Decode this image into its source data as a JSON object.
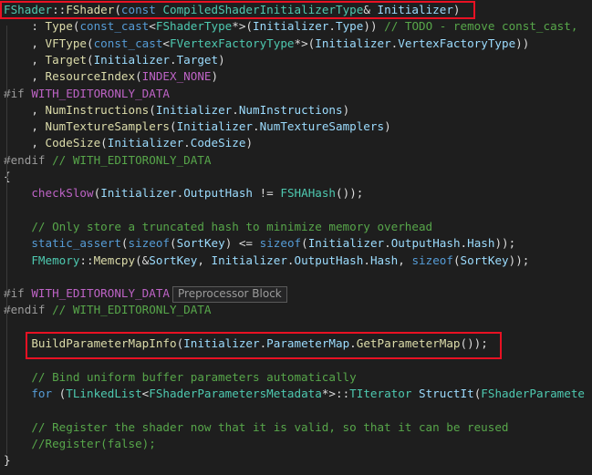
{
  "editor": {
    "lines": [
      {
        "tokens": [
          [
            "ty",
            "FShader"
          ],
          [
            "m",
            "::"
          ],
          [
            "fn",
            "FShader"
          ],
          [
            "m",
            "("
          ],
          [
            "kw",
            "const"
          ],
          [
            "m",
            " "
          ],
          [
            "ty",
            "CompiledShaderInitializerType"
          ],
          [
            "m",
            "& "
          ],
          [
            "var",
            "Initializer"
          ],
          [
            "m",
            ")"
          ]
        ]
      },
      {
        "tokens": [
          [
            "m",
            "    : "
          ],
          [
            "fn",
            "Type"
          ],
          [
            "m",
            "("
          ],
          [
            "kw",
            "const_cast"
          ],
          [
            "m",
            "<"
          ],
          [
            "ty",
            "FShaderType"
          ],
          [
            "m",
            "*>("
          ],
          [
            "var",
            "Initializer"
          ],
          [
            "m",
            "."
          ],
          [
            "field",
            "Type"
          ],
          [
            "m",
            ")) "
          ],
          [
            "cm",
            "// TODO - remove const_cast,"
          ]
        ]
      },
      {
        "tokens": [
          [
            "m",
            "    , "
          ],
          [
            "fn",
            "VFType"
          ],
          [
            "m",
            "("
          ],
          [
            "kw",
            "const_cast"
          ],
          [
            "m",
            "<"
          ],
          [
            "ty",
            "FVertexFactoryType"
          ],
          [
            "m",
            "*>("
          ],
          [
            "var",
            "Initializer"
          ],
          [
            "m",
            "."
          ],
          [
            "field",
            "VertexFactoryType"
          ],
          [
            "m",
            "))"
          ]
        ]
      },
      {
        "tokens": [
          [
            "m",
            "    , "
          ],
          [
            "fn",
            "Target"
          ],
          [
            "m",
            "("
          ],
          [
            "var",
            "Initializer"
          ],
          [
            "m",
            "."
          ],
          [
            "field",
            "Target"
          ],
          [
            "m",
            ")"
          ]
        ]
      },
      {
        "tokens": [
          [
            "m",
            "    , "
          ],
          [
            "fn",
            "ResourceIndex"
          ],
          [
            "m",
            "("
          ],
          [
            "idx",
            "INDEX_NONE"
          ],
          [
            "m",
            ")"
          ]
        ]
      },
      {
        "tokens": [
          [
            "pp",
            "#if "
          ],
          [
            "mac",
            "WITH_EDITORONLY_DATA"
          ]
        ]
      },
      {
        "tokens": [
          [
            "m",
            "    , "
          ],
          [
            "fn",
            "NumInstructions"
          ],
          [
            "m",
            "("
          ],
          [
            "var",
            "Initializer"
          ],
          [
            "m",
            "."
          ],
          [
            "field",
            "NumInstructions"
          ],
          [
            "m",
            ")"
          ]
        ]
      },
      {
        "tokens": [
          [
            "m",
            "    , "
          ],
          [
            "fn",
            "NumTextureSamplers"
          ],
          [
            "m",
            "("
          ],
          [
            "var",
            "Initializer"
          ],
          [
            "m",
            "."
          ],
          [
            "field",
            "NumTextureSamplers"
          ],
          [
            "m",
            ")"
          ]
        ]
      },
      {
        "tokens": [
          [
            "m",
            "    , "
          ],
          [
            "fn",
            "CodeSize"
          ],
          [
            "m",
            "("
          ],
          [
            "var",
            "Initializer"
          ],
          [
            "m",
            "."
          ],
          [
            "field",
            "CodeSize"
          ],
          [
            "m",
            ")"
          ]
        ]
      },
      {
        "tokens": [
          [
            "pp",
            "#endif "
          ],
          [
            "cm",
            "// WITH_EDITORONLY_DATA"
          ]
        ]
      },
      {
        "tokens": [
          [
            "m",
            "{"
          ]
        ]
      },
      {
        "tokens": [
          [
            "m",
            "    "
          ],
          [
            "mac",
            "checkSlow"
          ],
          [
            "m",
            "("
          ],
          [
            "var",
            "Initializer"
          ],
          [
            "m",
            "."
          ],
          [
            "field",
            "OutputHash"
          ],
          [
            "m",
            " != "
          ],
          [
            "ty",
            "FSHAHash"
          ],
          [
            "m",
            "());"
          ]
        ]
      },
      {
        "tokens": [
          [
            "m",
            ""
          ]
        ]
      },
      {
        "tokens": [
          [
            "m",
            "    "
          ],
          [
            "cm",
            "// Only store a truncated hash to minimize memory overhead"
          ]
        ]
      },
      {
        "tokens": [
          [
            "m",
            "    "
          ],
          [
            "kw",
            "static_assert"
          ],
          [
            "m",
            "("
          ],
          [
            "kw",
            "sizeof"
          ],
          [
            "m",
            "("
          ],
          [
            "field",
            "SortKey"
          ],
          [
            "m",
            ") <= "
          ],
          [
            "kw",
            "sizeof"
          ],
          [
            "m",
            "("
          ],
          [
            "var",
            "Initializer"
          ],
          [
            "m",
            "."
          ],
          [
            "field",
            "OutputHash"
          ],
          [
            "m",
            "."
          ],
          [
            "field",
            "Hash"
          ],
          [
            "m",
            "));"
          ]
        ]
      },
      {
        "tokens": [
          [
            "m",
            "    "
          ],
          [
            "ty",
            "FMemory"
          ],
          [
            "m",
            "::"
          ],
          [
            "fn",
            "Memcpy"
          ],
          [
            "m",
            "(&"
          ],
          [
            "field",
            "SortKey"
          ],
          [
            "m",
            ", "
          ],
          [
            "var",
            "Initializer"
          ],
          [
            "m",
            "."
          ],
          [
            "field",
            "OutputHash"
          ],
          [
            "m",
            "."
          ],
          [
            "field",
            "Hash"
          ],
          [
            "m",
            ", "
          ],
          [
            "kw",
            "sizeof"
          ],
          [
            "m",
            "("
          ],
          [
            "field",
            "SortKey"
          ],
          [
            "m",
            "));"
          ]
        ]
      },
      {
        "tokens": [
          [
            "m",
            ""
          ]
        ]
      },
      {
        "tokens": [
          [
            "pp",
            "#if "
          ],
          [
            "mac",
            "WITH_EDITORONLY_DATA"
          ]
        ],
        "tooltip": "Preprocessor Block"
      },
      {
        "tokens": [
          [
            "pp",
            "#endif "
          ],
          [
            "cm",
            "// WITH_EDITORONLY_DATA"
          ]
        ]
      },
      {
        "tokens": [
          [
            "m",
            ""
          ]
        ]
      },
      {
        "tokens": [
          [
            "m",
            "    "
          ],
          [
            "fn",
            "BuildParameterMapInfo"
          ],
          [
            "m",
            "("
          ],
          [
            "var",
            "Initializer"
          ],
          [
            "m",
            "."
          ],
          [
            "field",
            "ParameterMap"
          ],
          [
            "m",
            "."
          ],
          [
            "fn",
            "GetParameterMap"
          ],
          [
            "m",
            "());"
          ]
        ]
      },
      {
        "tokens": [
          [
            "m",
            ""
          ]
        ]
      },
      {
        "tokens": [
          [
            "m",
            "    "
          ],
          [
            "cm",
            "// Bind uniform buffer parameters automatically"
          ]
        ]
      },
      {
        "tokens": [
          [
            "m",
            "    "
          ],
          [
            "kw",
            "for"
          ],
          [
            "m",
            " ("
          ],
          [
            "ty",
            "TLinkedList"
          ],
          [
            "m",
            "<"
          ],
          [
            "ty",
            "FShaderParametersMetadata"
          ],
          [
            "m",
            "*>::"
          ],
          [
            "ty",
            "TIterator"
          ],
          [
            "m",
            " "
          ],
          [
            "var",
            "StructIt"
          ],
          [
            "m",
            "("
          ],
          [
            "ty",
            "FShaderParamete"
          ]
        ]
      },
      {
        "tokens": [
          [
            "m",
            ""
          ]
        ]
      },
      {
        "tokens": [
          [
            "m",
            "    "
          ],
          [
            "cm",
            "// Register the shader now that it is valid, so that it can be reused"
          ]
        ]
      },
      {
        "tokens": [
          [
            "m",
            "    "
          ],
          [
            "cm",
            "//Register(false);"
          ]
        ]
      },
      {
        "tokens": [
          [
            "m",
            "}"
          ]
        ]
      }
    ]
  }
}
